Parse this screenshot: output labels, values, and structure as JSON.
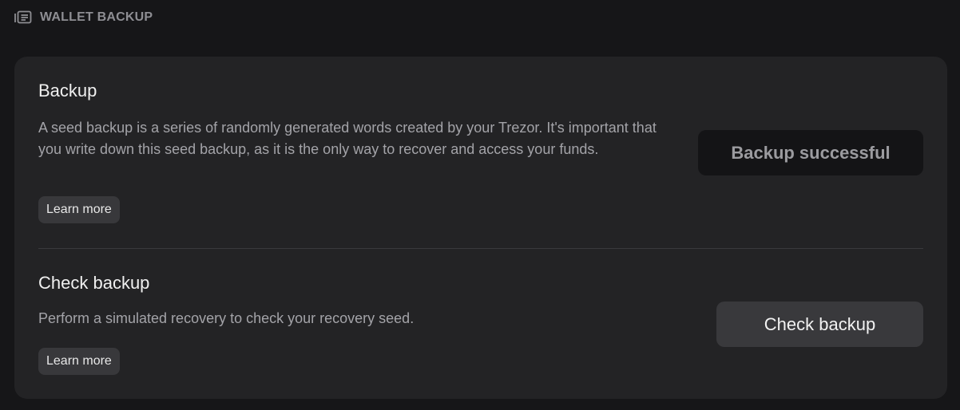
{
  "header": {
    "icon": "wallet-list-icon",
    "title": "WALLET BACKUP"
  },
  "backup": {
    "title": "Backup",
    "description": "A seed backup is a series of randomly generated words created by your Trezor. It's important that you write down this seed backup, as it is the only way to recover and access your funds.",
    "learn_more": "Learn more",
    "button_label": "Backup successful"
  },
  "check_backup": {
    "title": "Check backup",
    "description": "Perform a simulated recovery to check your recovery seed.",
    "learn_more": "Learn more",
    "button_label": "Check backup"
  },
  "colors": {
    "background": "#161618",
    "card": "#232325",
    "muted_text": "#a3a3a8"
  }
}
